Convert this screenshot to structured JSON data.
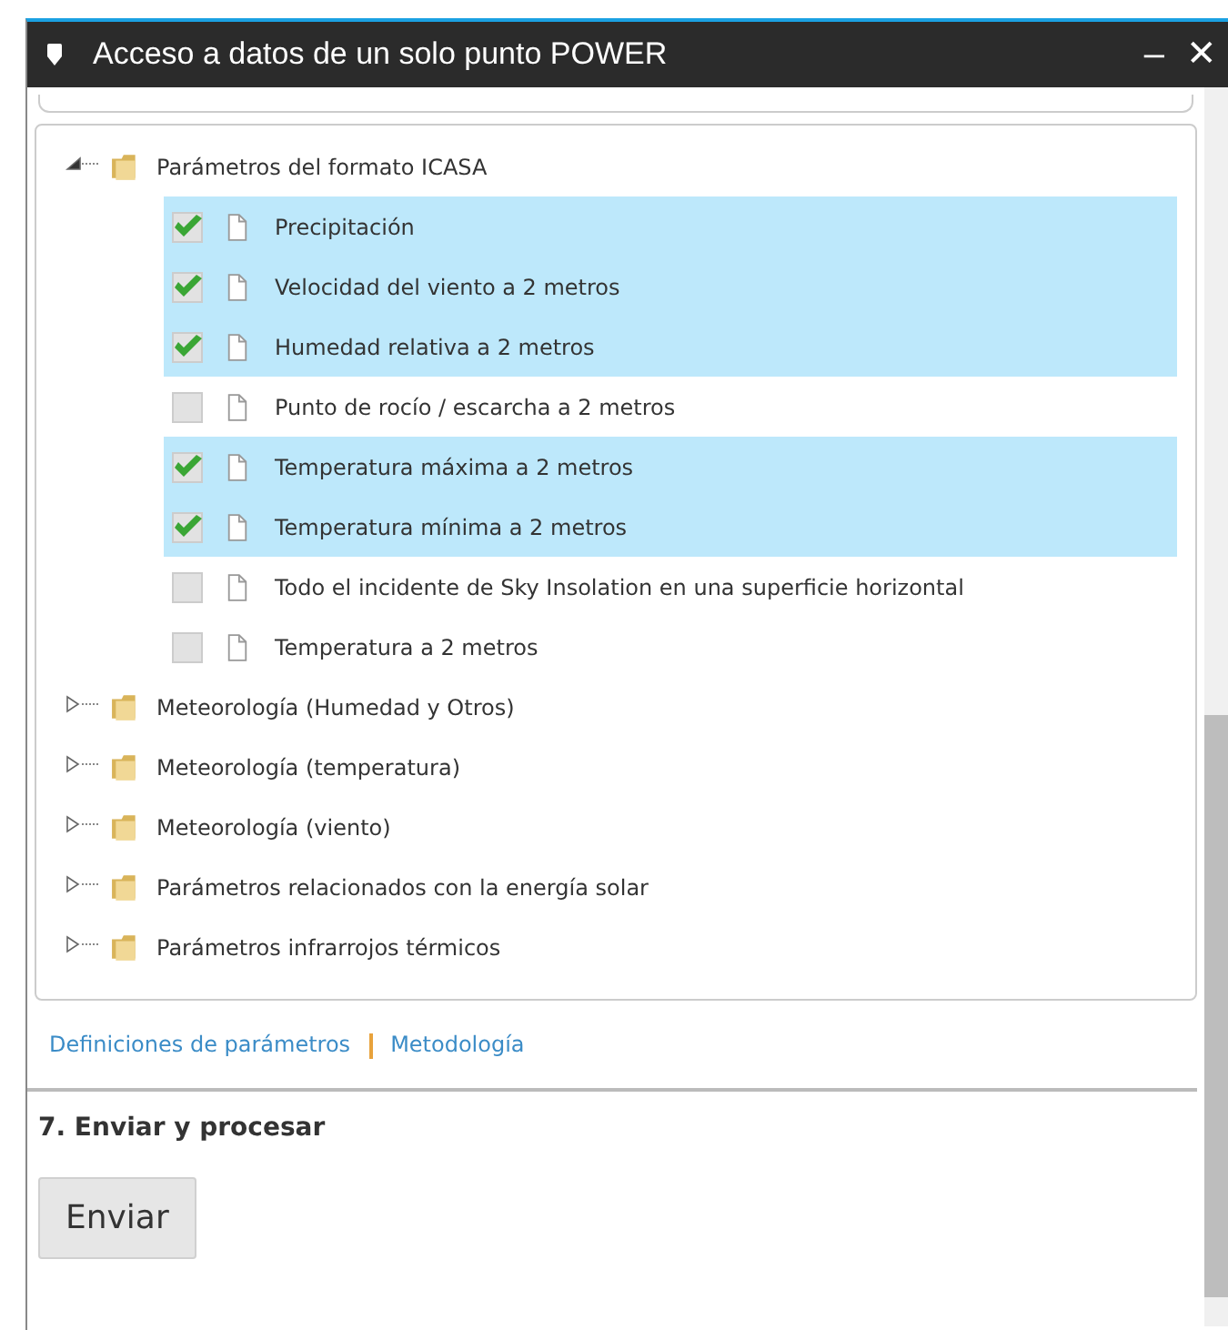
{
  "window": {
    "title": "Acceso a datos de un solo punto POWER",
    "buttons": [
      "–",
      "✕"
    ]
  },
  "tree": [
    {
      "label": "Parámetros del formato ICASA",
      "expanded": true,
      "children": [
        {
          "label": "Precipitación",
          "checked": true
        },
        {
          "label": "Velocidad del viento a 2 metros",
          "checked": true
        },
        {
          "label": "Humedad relativa a 2 metros",
          "checked": true
        },
        {
          "label": "Punto de rocío / escarcha a 2 metros",
          "checked": false
        },
        {
          "label": "Temperatura máxima a 2 metros",
          "checked": true
        },
        {
          "label": "Temperatura mínima a 2 metros",
          "checked": true
        },
        {
          "label": "Todo el incidente de Sky Insolation en una superficie horizontal",
          "checked": false
        },
        {
          "label": "Temperatura a 2 metros",
          "checked": false
        }
      ]
    },
    {
      "label": "Meteorología (Humedad y Otros)",
      "expanded": false
    },
    {
      "label": "Meteorología (temperatura)",
      "expanded": false
    },
    {
      "label": "Meteorología (viento)",
      "expanded": false
    },
    {
      "label": "Parámetros relacionados con la energía solar",
      "expanded": false
    },
    {
      "label": "Parámetros infrarrojos térmicos",
      "expanded": false
    }
  ],
  "links": [
    "Definiciones de parámetros",
    "Metodología"
  ],
  "section": {
    "heading": "7. Enviar y procesar",
    "button": "Enviar"
  }
}
